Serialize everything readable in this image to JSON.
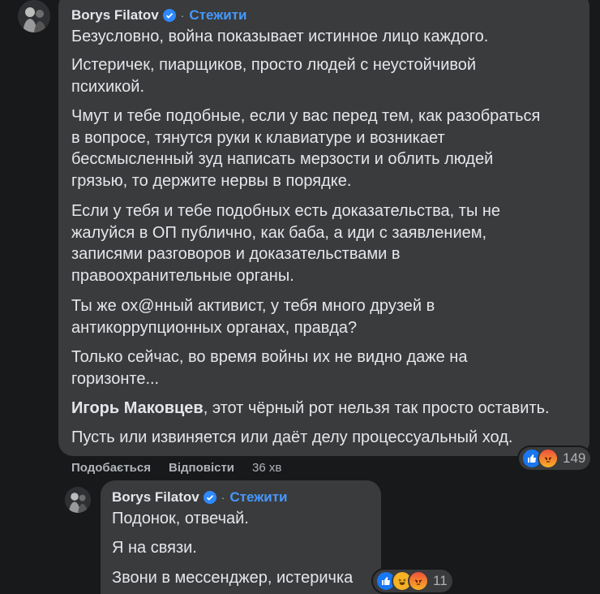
{
  "comment": {
    "author": "Borys Filatov",
    "follow_label": "Стежити",
    "separator": "·",
    "paragraphs": [
      [
        "Безусловно, война показывает истинное лицо каждого."
      ],
      [
        "Истеричек, пиарщиков, просто людей с неустойчивой",
        "психикой."
      ],
      [
        "Чмут и тебе подобные, если у вас перед тем, как разобраться",
        "в вопросе, тянутся руки к клавиатуре и возникает",
        "бессмысленный зуд написать мерзости и облить людей",
        "грязью, то держите нервы в порядке."
      ],
      [
        "Если у тебя и тебе подобных есть доказательства, ты не",
        "жалуйся в ОП публично, как баба, а иди с заявлением,",
        "записями разговоров и доказательствами в",
        "правоохранительные органы."
      ],
      [
        "Ты же ох@нный активист, у тебя много друзей в",
        "антикоррупционных органах, правда?"
      ],
      [
        "Только сейчас, во время войны их не видно даже на",
        "горизонте..."
      ]
    ],
    "mention": "Игорь Маковцев",
    "mention_rest": ", этот чёрный рот нельзя так просто оставить.",
    "last_paragraph": "Пусть или извиняется или даёт делу процессуальный ход.",
    "reactions": [
      "like-icon",
      "angry-icon"
    ],
    "reaction_count": "149",
    "like_label": "Подобається",
    "reply_label": "Відповісти",
    "time": "36 хв"
  },
  "reply": {
    "author": "Borys Filatov",
    "follow_label": "Стежити",
    "separator": "·",
    "lines": [
      "Подонок, отвечай.",
      "Я на связи.",
      "Звони в мессенджер, истеричка"
    ],
    "reactions": [
      "like-icon",
      "haha-icon",
      "angry-icon"
    ],
    "reaction_count": "11"
  }
}
